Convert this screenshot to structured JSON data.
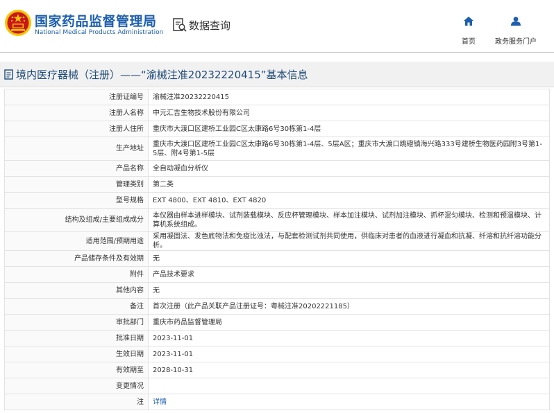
{
  "header": {
    "logo_cn": "国家药品监督管理局",
    "logo_en": "National Medical Products Administration",
    "query_label": "数据查询",
    "nav": [
      {
        "label": "首页",
        "icon": "home-icon"
      },
      {
        "label": "政务服务门户",
        "icon": "user-icon"
      }
    ]
  },
  "colors": {
    "brand_blue": "#1d5fae",
    "title_blue": "#1e4a7a",
    "emblem_red": "#c8161e",
    "emblem_gold": "#f5c400"
  },
  "page": {
    "title": "境内医疗器械（注册）——“渝械注准20232220415”基本信息"
  },
  "table": {
    "rows": [
      {
        "label": "注册证编号",
        "value": "渝械注准20232220415"
      },
      {
        "label": "注册人名称",
        "value": "中元汇吉生物技术股份有限公司"
      },
      {
        "label": "注册人住所",
        "value": "重庆市大渡口区建桥工业园C区太康路6号30栋第1-4层"
      },
      {
        "label": "生产地址",
        "value": "重庆市大渡口区建桥工业园C区太康路6号30栋第1-4层、5层A区；重庆市大渡口跳磴镇海兴路333号建桥生物医药园附3号第1-5层、附4号第1-5层"
      },
      {
        "label": "产品名称",
        "value": "全自动凝血分析仪"
      },
      {
        "label": "管理类别",
        "value": "第二类"
      },
      {
        "label": "型号规格",
        "value": "EXT 4800、EXT 4810、EXT 4820"
      },
      {
        "label": "结构及组成/主要组成成分",
        "value": "本仪器由样本进样模块、试剂装载模块、反应杯管理模块、样本加注模块、试剂加注模块、抓杯混匀模块、检测和预温模块、计算机系统组成。"
      },
      {
        "label": "适用范围/预期用途",
        "value": "采用凝固法、发色底物法和免疫比浊法，与配套检测试剂共同使用，供临床对患者的血液进行凝血和抗凝、纤溶和抗纤溶功能分析。"
      },
      {
        "label": "产品储存条件及有效期",
        "value": "无"
      },
      {
        "label": "附件",
        "value": "产品技术要求"
      },
      {
        "label": "其他内容",
        "value": "无"
      },
      {
        "label": "备注",
        "value": "首次注册（此产品关联产品注册证号：粤械注准20202221185）"
      },
      {
        "label": "审批部门",
        "value": "重庆市药品监督管理局"
      },
      {
        "label": "批准日期",
        "value": "2023-11-01"
      },
      {
        "label": "生效日期",
        "value": "2023-11-01"
      },
      {
        "label": "有效期至",
        "value": "2028-10-31"
      },
      {
        "label": "变更情况",
        "value": ""
      },
      {
        "label": "￼注",
        "value": "详情"
      }
    ]
  }
}
